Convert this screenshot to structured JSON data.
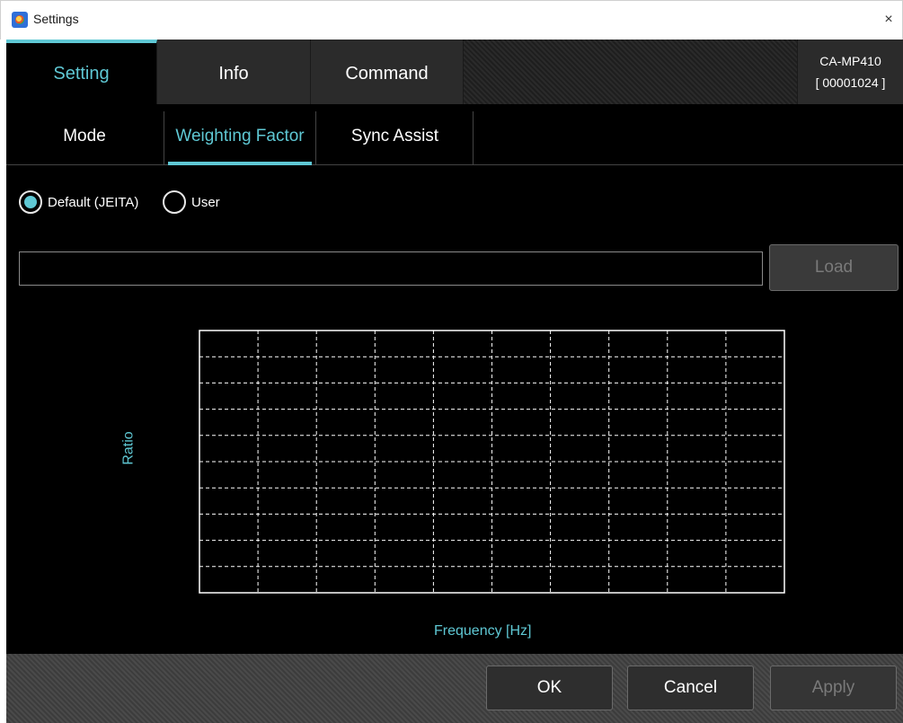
{
  "window": {
    "title": "Settings",
    "close_glyph": "×"
  },
  "main_tabs": [
    {
      "label": "Setting",
      "active": true
    },
    {
      "label": "Info",
      "active": false
    },
    {
      "label": "Command",
      "active": false
    }
  ],
  "device": {
    "model": "CA-MP410",
    "serial": "[ 00001024 ]"
  },
  "sub_tabs": [
    {
      "label": "Mode",
      "active": false
    },
    {
      "label": "Weighting Factor",
      "active": true
    },
    {
      "label": "Sync Assist",
      "active": false
    }
  ],
  "weighting": {
    "options": [
      {
        "label": "Default (JEITA)",
        "selected": true
      },
      {
        "label": "User",
        "selected": false
      }
    ],
    "file_path": "",
    "load_label": "Load"
  },
  "chart_data": {
    "type": "line",
    "title": "",
    "xlabel": "Frequency [Hz]",
    "ylabel": "Ratio",
    "series": [],
    "grid": true,
    "grid_columns": 10,
    "grid_rows": 10
  },
  "footer": {
    "ok_label": "OK",
    "cancel_label": "Cancel",
    "apply_label": "Apply"
  },
  "colors": {
    "accent": "#5fc8d4",
    "background": "#000000",
    "button": "#2e2e2e",
    "disabled_text": "#7a7a7a"
  }
}
